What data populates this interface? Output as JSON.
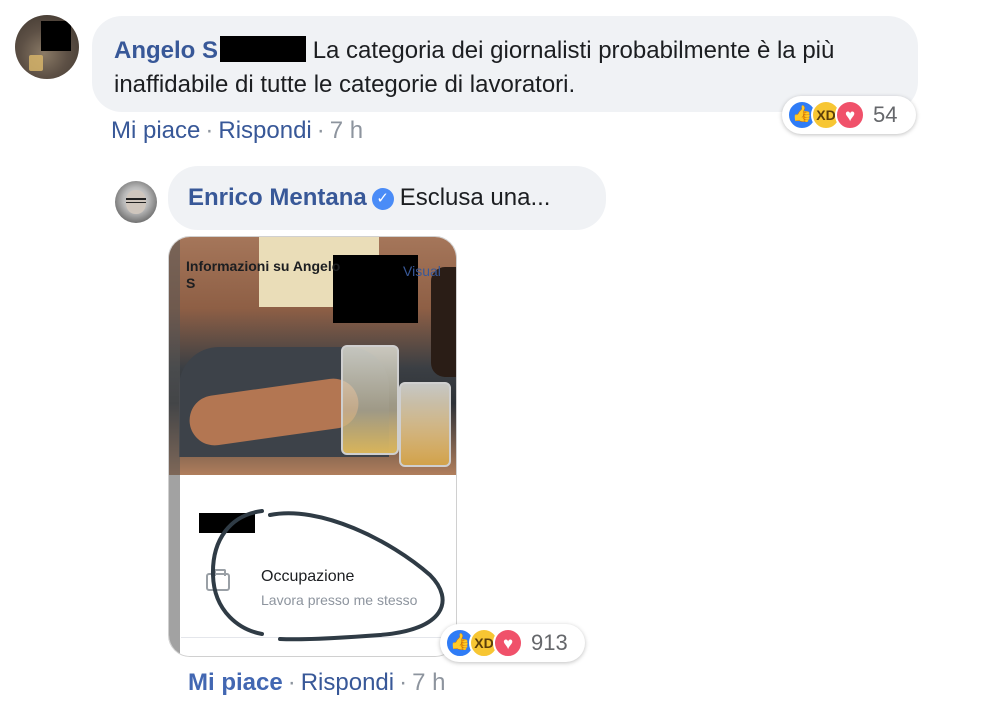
{
  "comment1": {
    "author": "Angelo S",
    "text": "La categoria dei giornalisti probabilmente è la più inaffidabile di tutte le categorie di lavoratori.",
    "actions": {
      "like": "Mi piace",
      "reply": "Rispondi",
      "time": "7 h"
    },
    "reactions": {
      "icons": [
        "like-icon",
        "haha-icon",
        "love-icon"
      ],
      "count": "54"
    }
  },
  "reply1": {
    "author": "Enrico Mentana",
    "verified_icon": "verified-badge-icon",
    "text": "Esclusa una...",
    "attachment": {
      "info_title_line1": "Informazioni su Angelo",
      "info_title_line2": "S",
      "view_link": "Visual",
      "occupation_label": "Occupazione",
      "occupation_value": "Lavora presso me stesso"
    },
    "actions": {
      "like": "Mi piace",
      "reply": "Rispondi",
      "time": "7 h"
    },
    "reactions": {
      "icons": [
        "like-icon",
        "haha-icon",
        "love-icon"
      ],
      "count": "913"
    }
  },
  "colors": {
    "author": "#385898",
    "bubble": "#f0f2f5",
    "meta": "#8d949e",
    "like": "#2f7cf6",
    "haha": "#f7c633",
    "love": "#f0516a",
    "scribble": "#2f3b45"
  }
}
